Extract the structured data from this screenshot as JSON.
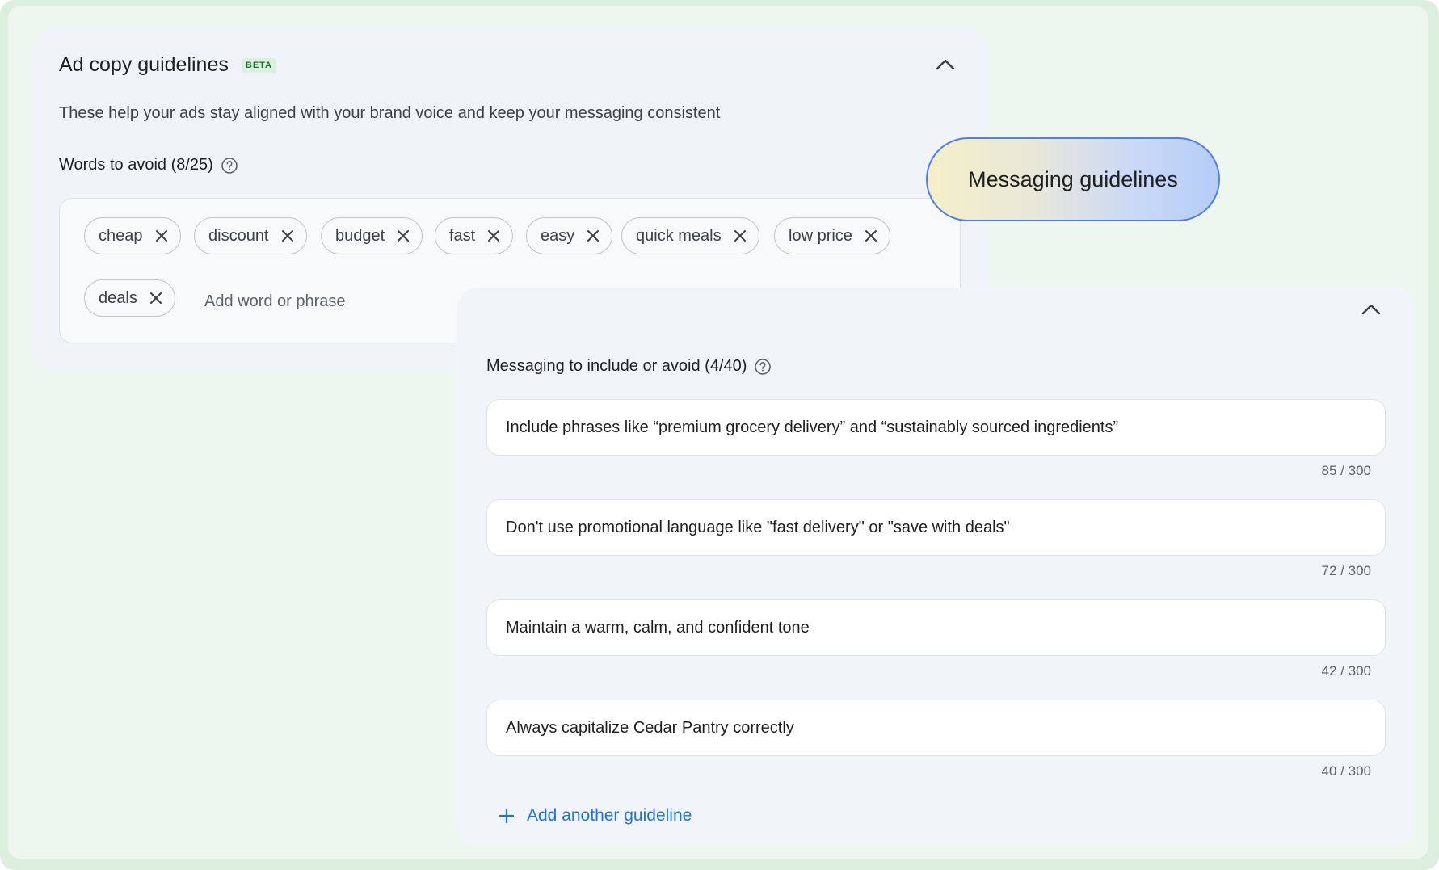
{
  "ad_copy": {
    "title": "Ad copy guidelines",
    "badge": "BETA",
    "description": "These help your ads stay aligned with your brand voice and keep your messaging consistent",
    "words_label": "Words to avoid (8/25)",
    "chips": [
      "cheap",
      "discount",
      "budget",
      "fast",
      "easy",
      "quick meals",
      "low price",
      "deals"
    ],
    "add_placeholder": "Add word or phrase"
  },
  "callout": {
    "label": "Messaging guidelines"
  },
  "messaging": {
    "label": "Messaging to include or avoid (4/40)",
    "guidelines": [
      {
        "text": "Include phrases like “premium grocery delivery” and “sustainably sourced ingredients”",
        "count": "85 / 300"
      },
      {
        "text": "Don't use promotional language like \"fast delivery\" or \"save with deals\"",
        "count": "72 / 300"
      },
      {
        "text": "Maintain a warm, calm, and confident tone",
        "count": "42 / 300"
      },
      {
        "text": "Always capitalize Cedar Pantry correctly",
        "count": "40 / 300"
      }
    ],
    "add_label": "Add another guideline"
  },
  "colors": {
    "accent": "#1a73e8",
    "beta_text": "#137333",
    "pill_border": "#4f7fe8"
  }
}
